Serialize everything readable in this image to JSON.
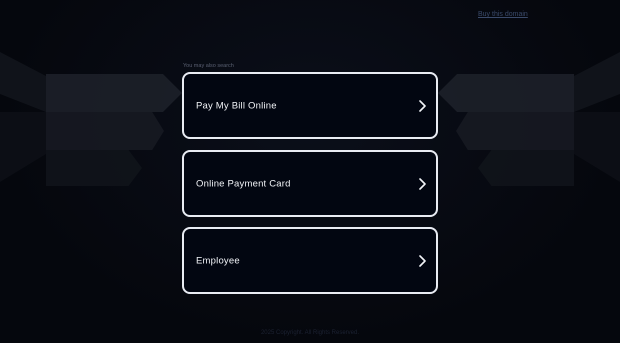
{
  "header": {
    "buy_link": "Buy this domain"
  },
  "main": {
    "hint": "You may also search",
    "cards": [
      {
        "label": "Pay My Bill Online"
      },
      {
        "label": "Online Payment Card"
      },
      {
        "label": "Employee"
      }
    ]
  },
  "footer": {
    "text": "2025 Copyright. All Rights Reserved."
  },
  "icons": {
    "card_arrow": "chevron-right-icon"
  },
  "colors": {
    "background": "#05070d",
    "card_border": "#e9ecf3",
    "card_fill": "#020611",
    "card_text": "#f2f4f8"
  }
}
